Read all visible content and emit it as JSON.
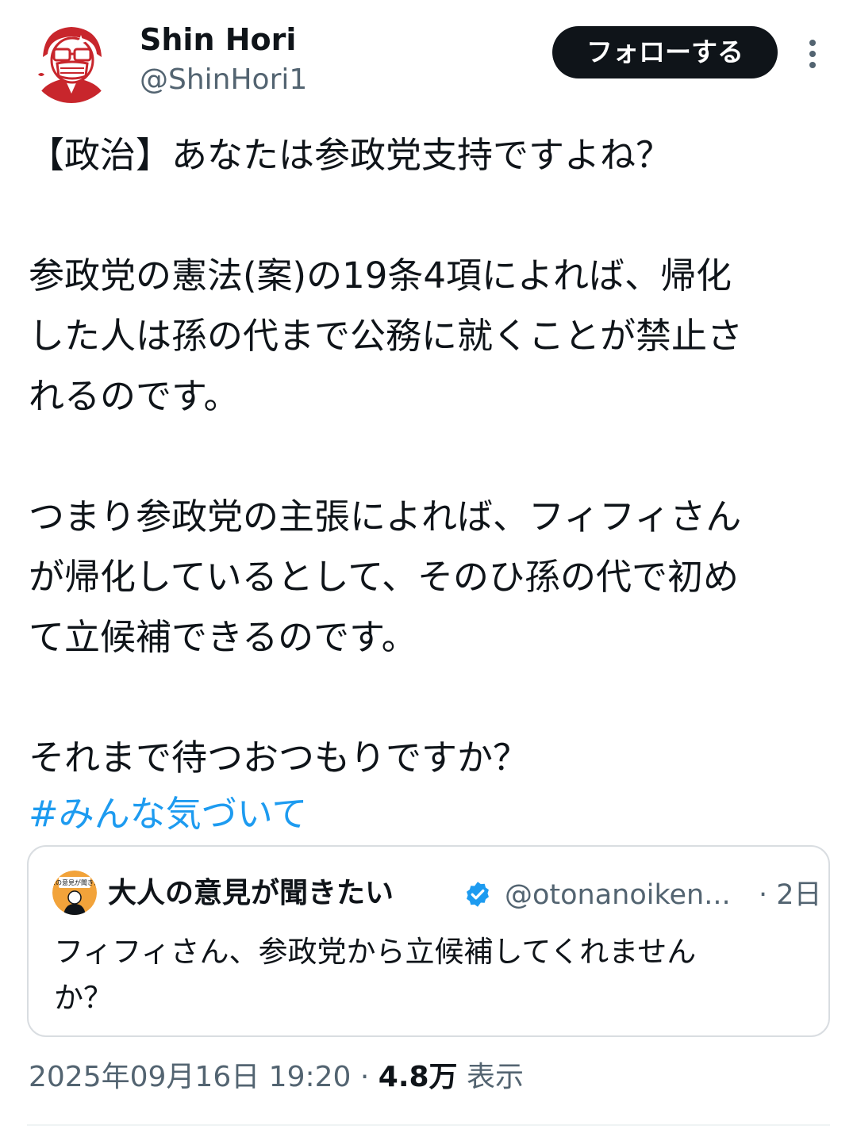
{
  "author": {
    "name": "Shin Hori",
    "handle": "@ShinHori1"
  },
  "follow_button": {
    "label": "フォローする"
  },
  "tweet": {
    "line1": "【政治】あなたは参政党支持ですよね？",
    "para2": [
      "参政党の憲法(案)の19条4項によれば、帰化",
      "した人は孫の代まで公務に就くことが禁止さ",
      "れるのです。"
    ],
    "para3": [
      "つまり参政党の主張によれば、フィフィさん",
      "が帰化しているとして、そのひ孫の代で初め",
      "て立候補できるのです。"
    ],
    "line4": "それまで待つおつもりですか？",
    "hashtag": "#みんな気づいて"
  },
  "quote": {
    "name": "大人の意見が聞きたい",
    "handle": "@otonanoiken...",
    "time": "· 2日",
    "text_lines": [
      "フィフィさん、参政党から立候補してくれません",
      "か？"
    ],
    "avatar_text": "大人の意見が聞きたい"
  },
  "meta": {
    "datetime": "2025年09月16日 19:20 · ",
    "views": "4.8万",
    "views_label": " 表示"
  },
  "colors": {
    "text": "#0f1419",
    "secondary": "#536471",
    "hashtag": "#1d9bf0",
    "verified": "#1d9bf0",
    "avatar_red": "#c8262c"
  }
}
